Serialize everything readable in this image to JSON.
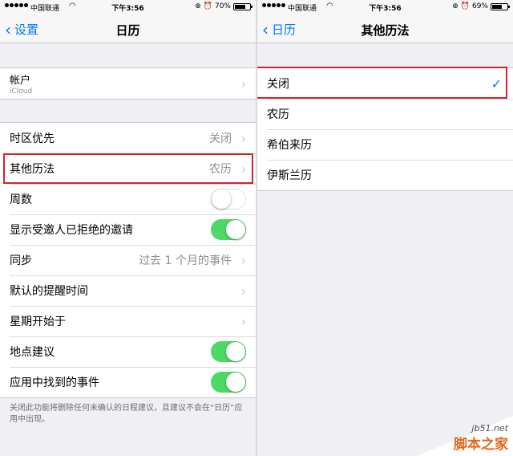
{
  "left": {
    "status": {
      "carrier": "中国联通",
      "time": "下午3:56",
      "battery": "70%",
      "battery_level": 0.7
    },
    "nav": {
      "back_label": "设置",
      "title": "日历"
    },
    "account": {
      "label": "帐户",
      "sub": "iCloud"
    },
    "rows": [
      {
        "label": "时区优先",
        "value": "关闭"
      },
      {
        "label": "其他历法",
        "value": "农历"
      },
      {
        "label": "周数",
        "toggle": false
      },
      {
        "label": "显示受邀人已拒绝的邀请",
        "toggle": true
      },
      {
        "label": "同步",
        "value": "过去 1 个月的事件"
      },
      {
        "label": "默认的提醒时间"
      },
      {
        "label": "星期开始于"
      },
      {
        "label": "地点建议",
        "toggle": true
      },
      {
        "label": "应用中找到的事件",
        "toggle": true
      }
    ],
    "footer": "关闭此功能将删除任何未确认的日程建议，且建议不会在“日历”应用中出现。"
  },
  "right": {
    "status": {
      "carrier": "中国联通",
      "time": "下午3:56",
      "battery": "69%",
      "battery_level": 0.69
    },
    "nav": {
      "back_label": "日历",
      "title": "其他历法"
    },
    "options": [
      {
        "label": "关闭",
        "selected": true
      },
      {
        "label": "农历"
      },
      {
        "label": "希伯来历"
      },
      {
        "label": "伊斯兰历"
      }
    ]
  },
  "watermark": {
    "site": "jb51.net",
    "name": "脚本之家"
  },
  "colors": {
    "accent": "#007aff",
    "toggle_on": "#4cd964",
    "highlight": "#d2232a"
  }
}
